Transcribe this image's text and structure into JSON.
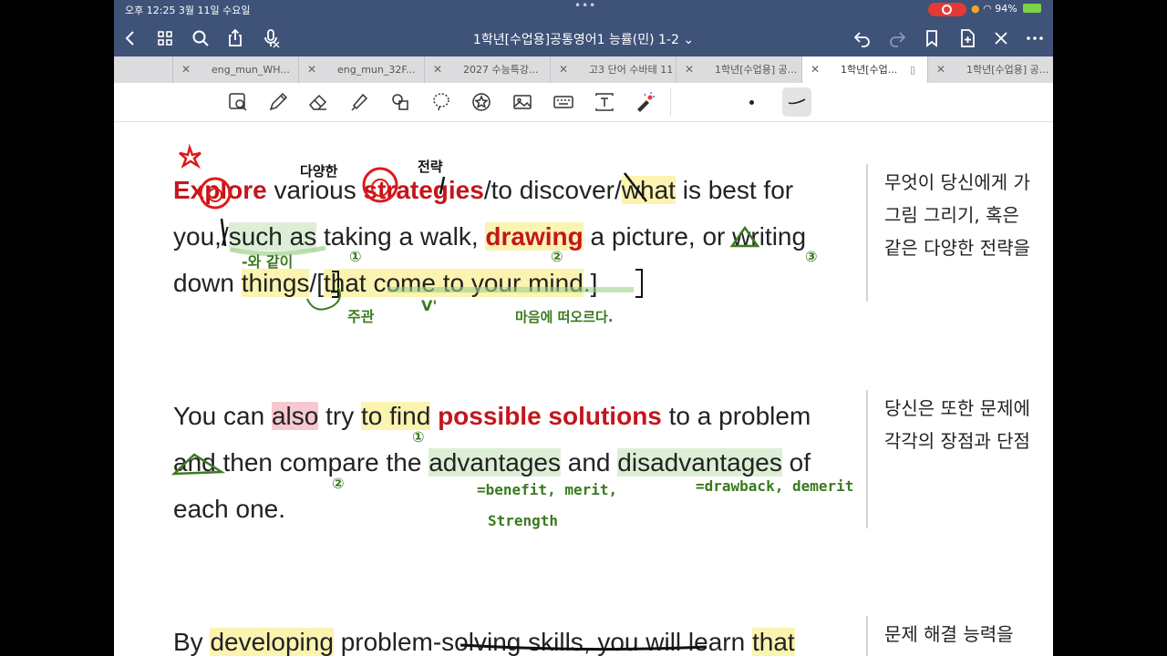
{
  "status": {
    "time": "오후 12:25  3월 11일 수요일",
    "battery": "94%"
  },
  "nav": {
    "title": "1학년[수업용]공통영어1 능률(민)  1-2 ⌄"
  },
  "tabs": [
    {
      "label": "eng_mun_WH..."
    },
    {
      "label": "eng_mun_32F..."
    },
    {
      "label": "2027 수능특강..."
    },
    {
      "label": "고3 단어 수바테 11"
    },
    {
      "label": "1학년[수업용] 공..."
    },
    {
      "label": "1학년[수업..."
    },
    {
      "label": "1학년[수업용] 공..."
    }
  ],
  "content": {
    "p1": {
      "w1": "Explore",
      "w2": " various ",
      "w3": "strategies",
      "w4": "/to discover/",
      "w5": "what",
      "w6": " is best for you,/",
      "w7": "such as",
      "w8": " taking a walk, ",
      "w9": "drawing",
      "w10": " a picture, or writing down ",
      "w11": "things",
      "w12": "/[",
      "w13": "that come to your mind",
      "w14": ".]"
    },
    "p2": {
      "w1": "You can ",
      "w2": "also",
      "w3": " try ",
      "w4": "to find",
      "w5": " ",
      "w6": "possible solutions",
      "w7": " to a problem and then compare the ",
      "w8": "advantages",
      "w9": " and ",
      "w10": "disadvantages",
      "w11": " of each one."
    },
    "p3": {
      "w1": "By ",
      "w2": "developing",
      "w3": " problem-solving skills, you will learn ",
      "w4": "that"
    },
    "korean": {
      "k1": [
        "무엇이 당신에게 가",
        "그림 그리기, 혹은",
        "같은 다양한 전략을"
      ],
      "k2": [
        "당신은 또한 문제에",
        "각각의 장점과 단점"
      ],
      "k3": [
        "문제 해결 능력을"
      ]
    },
    "annotations": {
      "a_diverse": "다양한",
      "a_strategy": "전략",
      "a_like": "-와 같이",
      "a_n1": "①",
      "a_n2": "②",
      "a_n3": "③",
      "a_subj": "주관",
      "a_v": "V'",
      "a_mind": "마음에 떠오르다.",
      "a_tofind_n1": "①",
      "a_compare_n2": "②",
      "a_benefit": "=benefit, merit,",
      "a_strength": "Strength",
      "a_drawback": "=drawback, demerit"
    }
  }
}
